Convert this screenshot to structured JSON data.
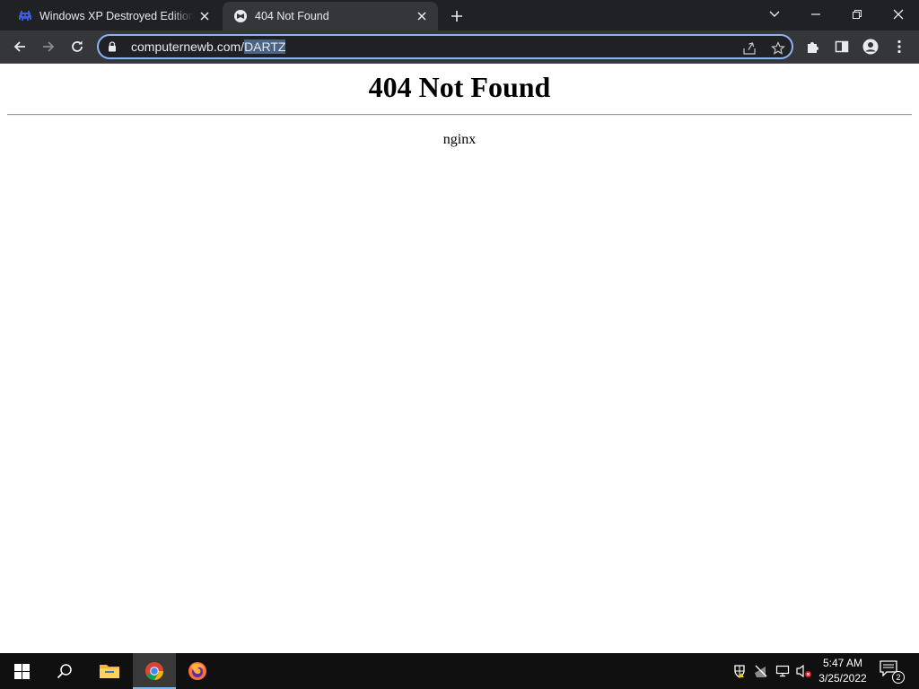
{
  "browser": {
    "tabs": [
      {
        "title": "Windows XP Destroyed Edition V",
        "active": false,
        "favicon": "space-invader-icon"
      },
      {
        "title": "404 Not Found",
        "active": true,
        "favicon": "nginx-favicon-icon"
      }
    ],
    "address": {
      "host": "computernewb.com/",
      "path": "DARTZ"
    },
    "accent": "#8ab4f8",
    "frame_color": "#202124",
    "toolbar_color": "#35363a"
  },
  "page": {
    "heading": "404 Not Found",
    "server": "nginx"
  },
  "taskbar": {
    "apps": [
      "start-icon",
      "search-icon",
      "file-explorer-icon",
      "chrome-icon",
      "firefox-icon"
    ],
    "active_app": "chrome-icon",
    "time": "5:47 AM",
    "date": "3/25/2022",
    "notification_count": "2"
  }
}
